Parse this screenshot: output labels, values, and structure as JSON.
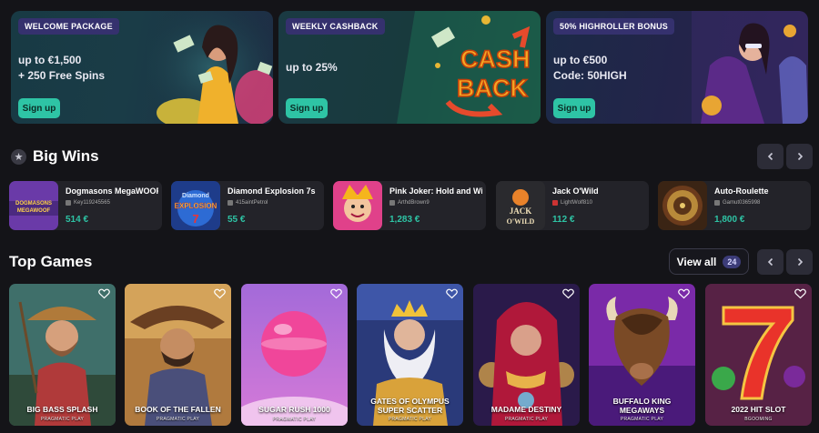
{
  "promos": [
    {
      "tag": "WELCOME PACKAGE",
      "line1": "up to €1,500",
      "line2": "+ 250 Free Spins",
      "button": "Sign up",
      "art_text": ""
    },
    {
      "tag": "WEEKLY CASHBACK",
      "line1": "up to 25%",
      "line2": "",
      "button": "Sign up",
      "art_text": "CASH BACK"
    },
    {
      "tag": "50% HIGHROLLER BONUS",
      "line1": "up to €500",
      "line2": "Code: 50HIGH",
      "button": "Sign up",
      "art_text": ""
    }
  ],
  "big_wins": {
    "title": "Big Wins",
    "items": [
      {
        "game": "Dogmasons MegaWOOF",
        "user": "Key119245565",
        "amount": "514 €",
        "thumb_text": "DOGMASONS MEGAWOOF"
      },
      {
        "game": "Diamond Explosion 7s",
        "user": "415aintPetrol",
        "amount": "55 €",
        "thumb_text": "EXPLOSION"
      },
      {
        "game": "Pink Joker: Hold and Win",
        "user": "ArthdBrown9",
        "amount": "1,283 €",
        "thumb_text": ""
      },
      {
        "game": "Jack O'Wild",
        "user": "LightWolf810",
        "amount": "112 €",
        "thumb_text": "JACK O'WILD"
      },
      {
        "game": "Auto-Roulette",
        "user": "Gamut0365998",
        "amount": "1,800 €",
        "thumb_text": ""
      }
    ]
  },
  "top_games": {
    "title": "Top Games",
    "view_all": "View all",
    "count": "24",
    "items": [
      {
        "name": "BIG BASS SPLASH",
        "provider": "PRAGMATIC PLAY"
      },
      {
        "name": "BOOK OF THE FALLEN",
        "provider": "PRAGMATIC PLAY"
      },
      {
        "name": "SUGAR RUSH 1000",
        "provider": "PRAGMATIC PLAY"
      },
      {
        "name": "GATES OF OLYMPUS SUPER SCATTER",
        "provider": "PRAGMATIC PLAY"
      },
      {
        "name": "MADAME DESTINY",
        "provider": "PRAGMATIC PLAY"
      },
      {
        "name": "BUFFALO KING MEGAWAYS",
        "provider": "PRAGMATIC PLAY"
      },
      {
        "name": "2022 HIT SLOT",
        "provider": "BGOOMING"
      }
    ]
  },
  "icons": {
    "section_icon": "star-icon",
    "prev": "chevron-left-icon",
    "next": "chevron-right-icon",
    "favorite": "heart-icon"
  },
  "colors": {
    "accent": "#2ec4a5",
    "background": "#141418",
    "tag": "#35316e"
  }
}
